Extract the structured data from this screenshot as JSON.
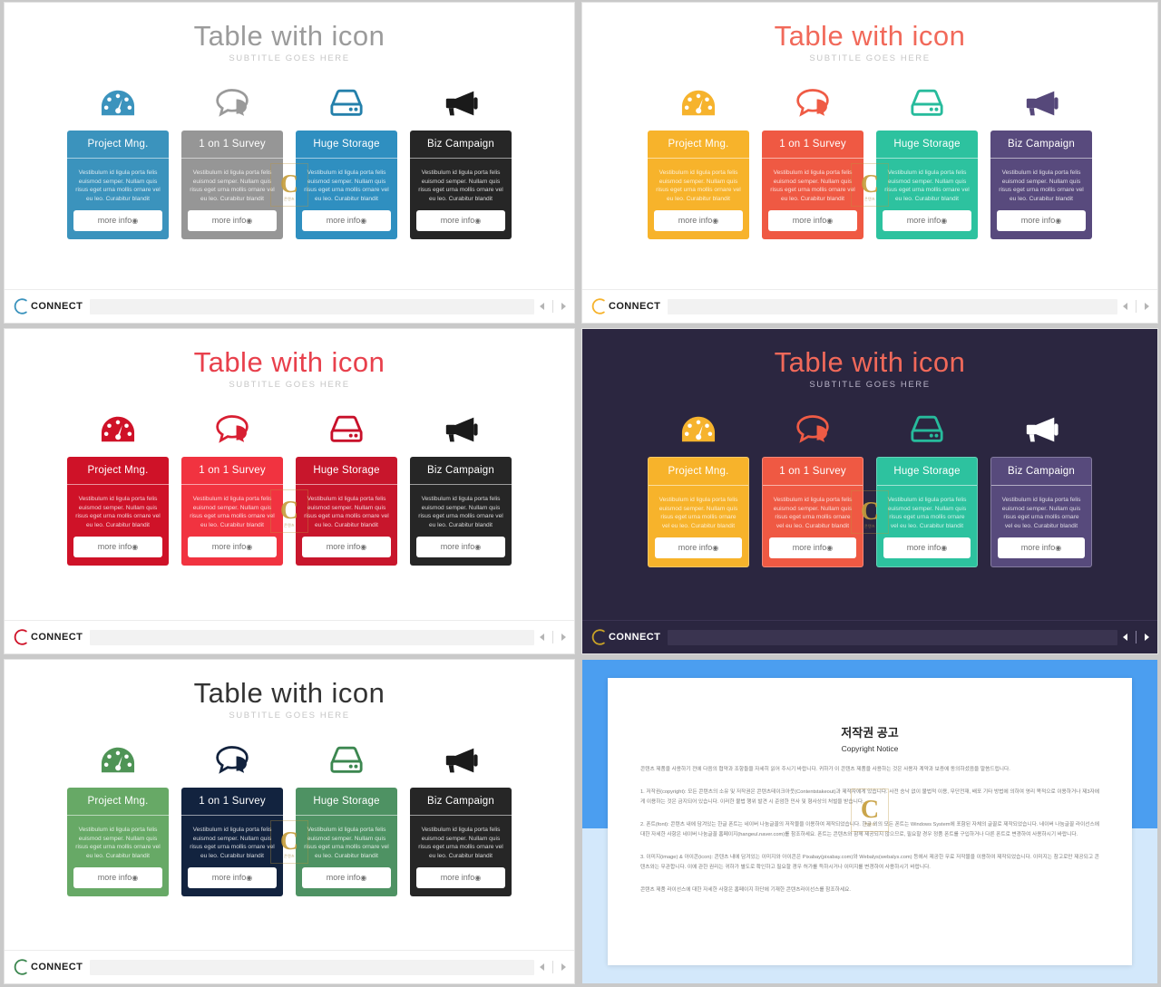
{
  "slide_common": {
    "title": "Table with icon",
    "subtitle": "SUBTITLE GOES HERE",
    "logo_text": "CONNECT",
    "nav_prev": "prev-arrow",
    "nav_next": "next-arrow",
    "watermark_letter": "C",
    "watermark_caption": "콘텐츠",
    "body_text": "Vestibulum id ligula porta felis euismod semper. Nullam quis risus eget urna mollis ornare vel eu leo. Curabitur blandit",
    "button_label": "more info",
    "button_icon": "target-circle-icon",
    "columns": [
      {
        "title": "Project Mng.",
        "icon": "gauge-icon"
      },
      {
        "title": "1 on 1 Survey",
        "icon": "speech-bubbles-icon"
      },
      {
        "title": "Huge Storage",
        "icon": "hard-drive-icon"
      },
      {
        "title": "Biz Campaign",
        "icon": "megaphone-icon"
      }
    ]
  },
  "slides": [
    {
      "name": "blue-theme",
      "theme": "light",
      "title_color": "#9b9b9b",
      "icon_colors": [
        "#3b93bd",
        "#9a9a9a",
        "#2480ab",
        "#1a1a1a"
      ],
      "card_colors": [
        "#3b93bd",
        "#969696",
        "#2f8fc0",
        "#262626"
      ],
      "logo_arc_color": "#3b93bd"
    },
    {
      "name": "orange-theme",
      "theme": "light",
      "title_color": "#f1695a",
      "icon_colors": [
        "#f6b32d",
        "#ef5b45",
        "#27bb9c",
        "#56487a"
      ],
      "card_colors": [
        "#f7b32b",
        "#ef5943",
        "#2dc29f",
        "#584a7d"
      ],
      "logo_arc_color": "#f6b32d"
    },
    {
      "name": "red-theme",
      "theme": "light",
      "title_color": "#e8404c",
      "icon_colors": [
        "#cf1228",
        "#d81f32",
        "#c8102a",
        "#1a1a1a"
      ],
      "card_colors": [
        "#cf1228",
        "#f13340",
        "#c8162c",
        "#262626"
      ],
      "logo_arc_color": "#cf1228"
    },
    {
      "name": "dark-theme",
      "theme": "dark",
      "title_color": "#f1695a",
      "icon_colors": [
        "#f6b32d",
        "#ef5b45",
        "#27bb9c",
        "#ffffff"
      ],
      "card_colors": [
        "#f7b32b",
        "#ef5943",
        "#2dc29f",
        "#574a7c"
      ],
      "logo_arc_color": "#c9a227"
    },
    {
      "name": "green-theme",
      "theme": "light",
      "title_color": "#333333",
      "icon_colors": [
        "#4f9456",
        "#12223d",
        "#3c8750",
        "#1a1a1a"
      ],
      "card_colors": [
        "#67a966",
        "#12233f",
        "#4e9263",
        "#262626"
      ],
      "logo_arc_color": "#3c8750"
    }
  ],
  "copyright": {
    "title": "저작권 공고",
    "subtitle": "Copyright Notice",
    "paragraphs": [
      "콘텐츠 제품을 사용하기 전에 다음의 협약과 조항들을 자세히 읽어 주시기 바랍니다. 귀하가 이 콘텐츠 제품을 사용하는 것은 사용자 계약과 보증에 동의하셨음을 말씀드립니다.",
      "1. 저작권(copyright): 모든 콘텐츠의 소유 및 저작권은 콘텐츠테이크아웃(Contentstakeout)과 제작자에게 있습니다. 사전 승낙 없이 불법적 이용, 무단전재, 배포 기타 방법에 의하여 영리 목적으로 이용하거나 제3자에게 이용하는 것은 금지되어 있습니다. 이러한 불법 행위 발견 시 준엄한 민사 및 형사상의 처벌을 받습니다.",
      "2. 폰트(font): 콘텐츠 내에 담겨있는 한글 폰트는 네이버 나눔글꼴의 저작물을 이용하여 제작되었습니다. 한글 외의 모든 폰트는 Windows System에 포함된 자체의 글꼴로 제작되었습니다. 네이버 나눔글꼴 라이선스에 대한 자세한 사항은 네이버 나눔글꼴 홈페이지(hangeul.naver.com)를 참조하세요. 폰트는 콘텐츠와 함께 제공되지 않으므로, 필요할 경우 정품 폰트를 구입하거나 다른 폰트로 변경하여 사용하시기 바랍니다.",
      "3. 이미지(image) & 아이콘(icon): 콘텐츠 내에 담겨있는 이미지와 아이콘은 Pixabay(pixabay.com)와 Webalys(webalys.com) 등에서 제공한 무료 저작물을 이용하여 제작되었습니다. 이미지는 참고로만 제공되고 콘텐츠와는 무관합니다. 이에 관한 권리는 귀하가 별도로 확인하고 필요할 경우 허가를 득하시거나 이미지를 변경하여 사용하시기 바랍니다.",
      "콘텐츠 제품 라이선스에 대한 자세한 사항은 홈페이지 하단에 기재한 콘텐츠라이선스를 참조하세요."
    ]
  }
}
